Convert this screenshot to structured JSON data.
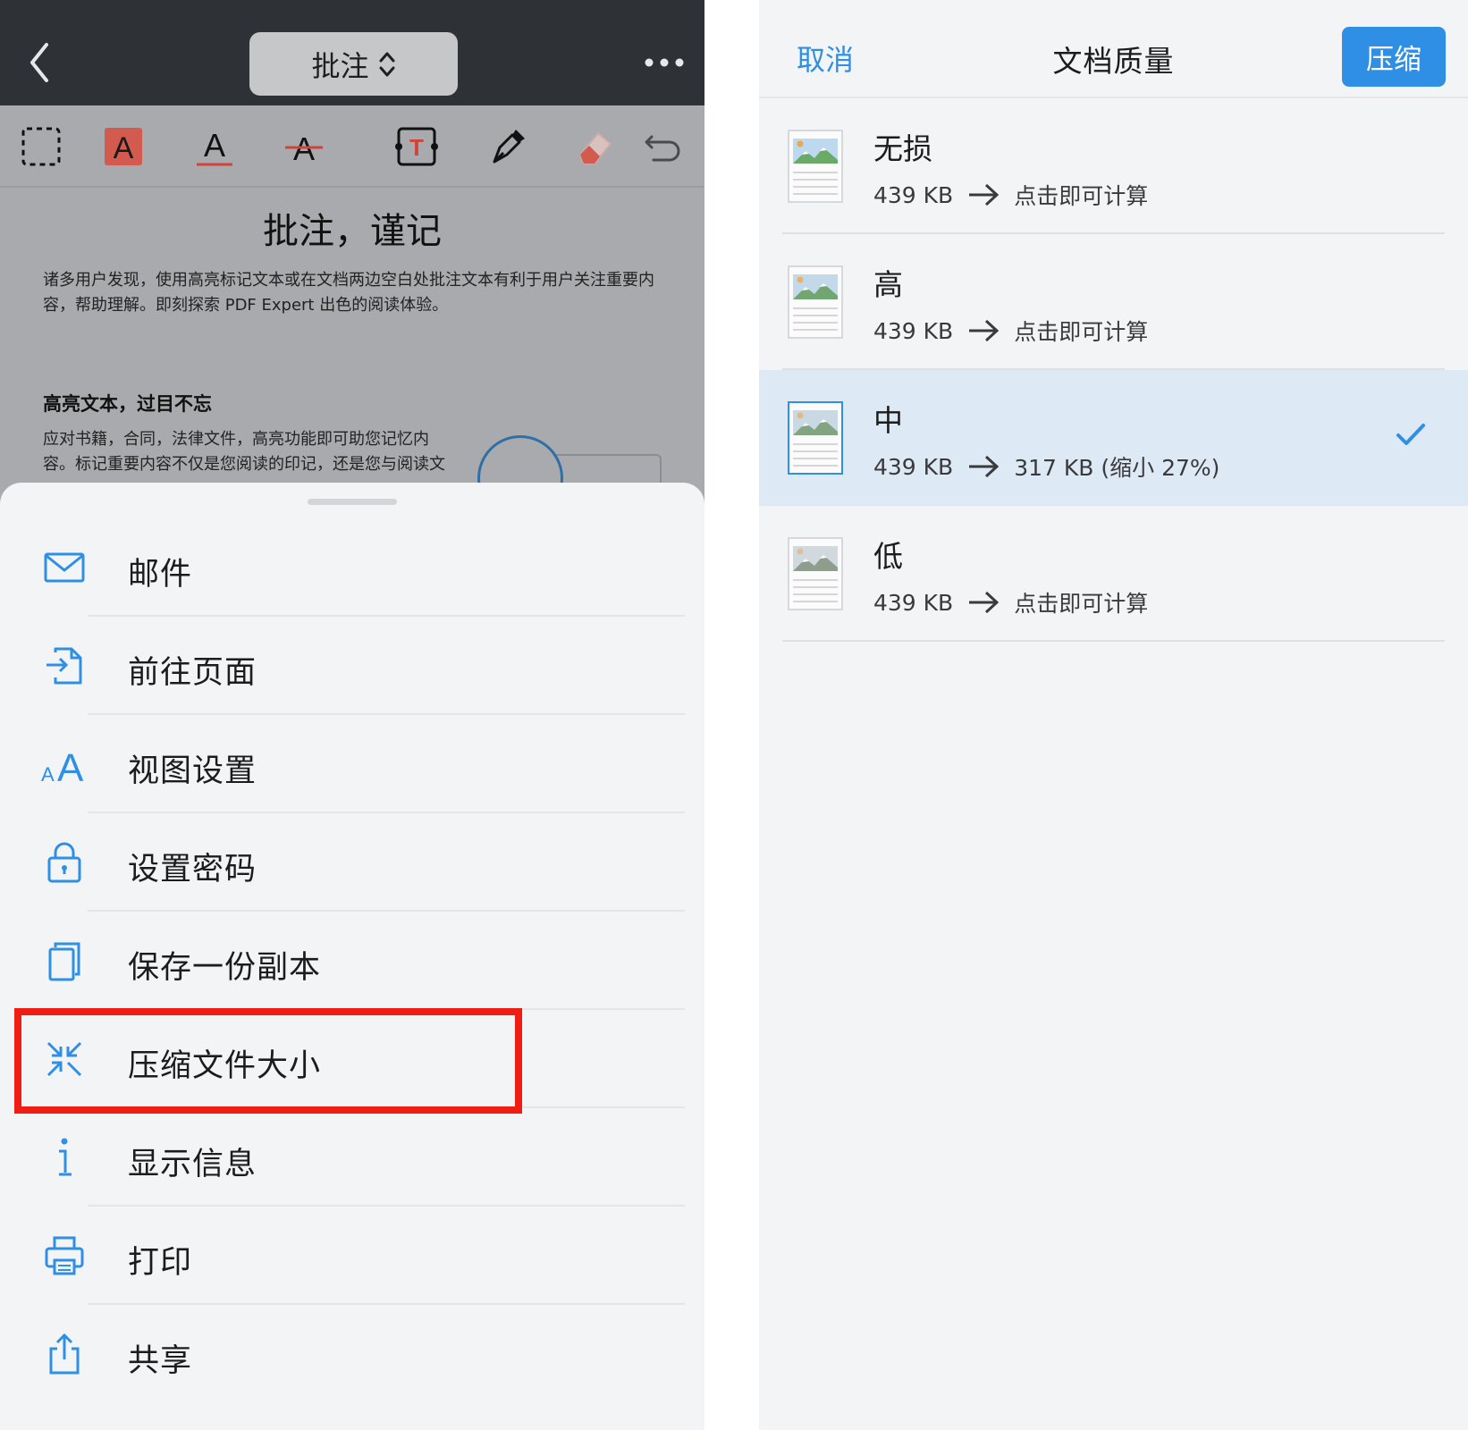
{
  "left": {
    "topbar": {
      "mode_label": "批注"
    },
    "doc": {
      "title": "批注，谨记",
      "intro_line1": "诸多用户发现，使用高亮标记文本或在文档两边空白处批注文本有利于用户关注重要内",
      "intro_line2": "容，帮助理解。即刻探索 PDF Expert 出色的阅读体验。",
      "heading": "高亮文本，过目不忘",
      "body_line1": "应对书籍，合同，法律文件，高亮功能即可助您记忆内",
      "body_line2": "容。标记重要内容不仅是您阅读的印记，还是您与阅读文"
    },
    "menu": {
      "items": [
        {
          "label": "邮件",
          "icon": "mail-icon"
        },
        {
          "label": "前往页面",
          "icon": "go-to-page-icon"
        },
        {
          "label": "视图设置",
          "icon": "text-size-icon"
        },
        {
          "label": "设置密码",
          "icon": "lock-icon"
        },
        {
          "label": "保存一份副本",
          "icon": "copy-icon"
        },
        {
          "label": "压缩文件大小",
          "icon": "compress-icon"
        },
        {
          "label": "显示信息",
          "icon": "info-icon"
        },
        {
          "label": "打印",
          "icon": "printer-icon"
        },
        {
          "label": "共享",
          "icon": "share-icon"
        }
      ]
    }
  },
  "right": {
    "header": {
      "cancel": "取消",
      "title": "文档质量",
      "compress": "压缩"
    },
    "options": [
      {
        "name": "无损",
        "from": "439 KB",
        "to": "点击即可计算",
        "selected": false
      },
      {
        "name": "高",
        "from": "439 KB",
        "to": "点击即可计算",
        "selected": false
      },
      {
        "name": "中",
        "from": "439 KB",
        "to": "317 KB (缩小 27%)",
        "selected": true
      },
      {
        "name": "低",
        "from": "439 KB",
        "to": "点击即可计算",
        "selected": false
      }
    ]
  },
  "colors": {
    "accent": "#2f8fe5",
    "highlight_box": "#ef1d13",
    "topbar": "#2e3236",
    "selected_row": "#dde9f4"
  }
}
